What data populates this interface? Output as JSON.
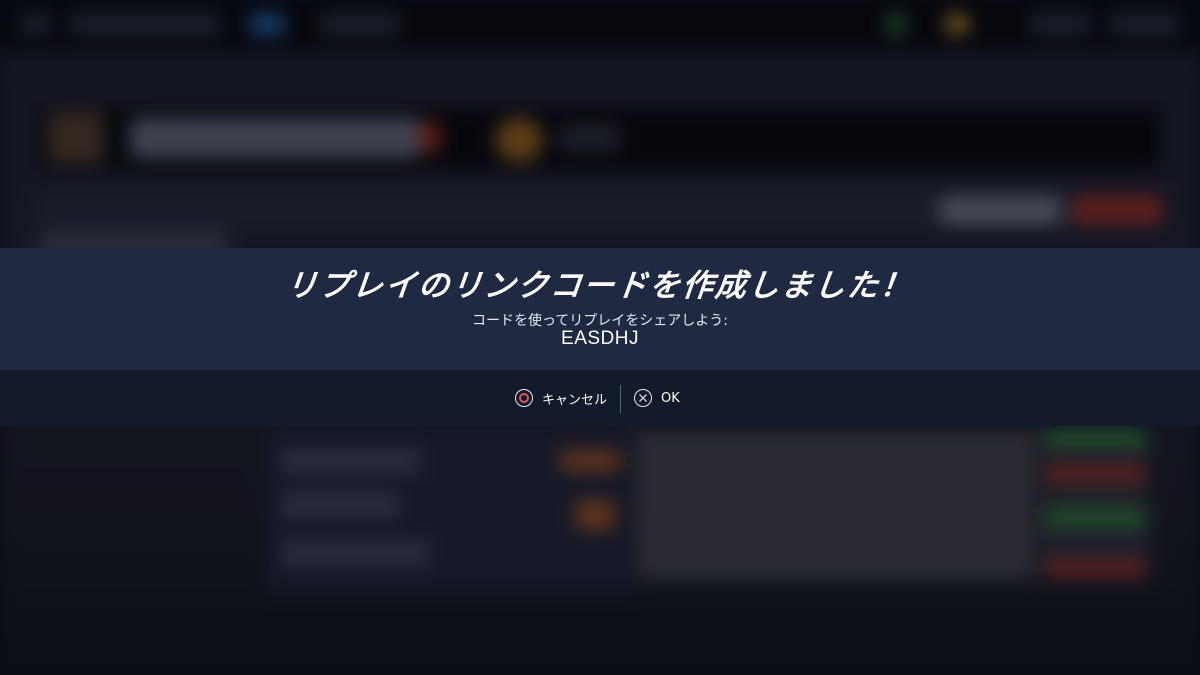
{
  "dialog": {
    "title": "リプレイのリンクコードを作成しました！",
    "message": "コードを使ってリプレイをシェアしよう:",
    "code": "EASDHJ"
  },
  "buttons": {
    "cancel": {
      "label": "キャンセル",
      "icon": "circle-button-icon",
      "icon_color": "#e2565a"
    },
    "ok": {
      "label": "OK",
      "icon": "cross-button-icon"
    }
  },
  "colors": {
    "dialog_top": "#1f2a42",
    "dialog_bottom": "#121a2b",
    "text": "#ffffff"
  }
}
